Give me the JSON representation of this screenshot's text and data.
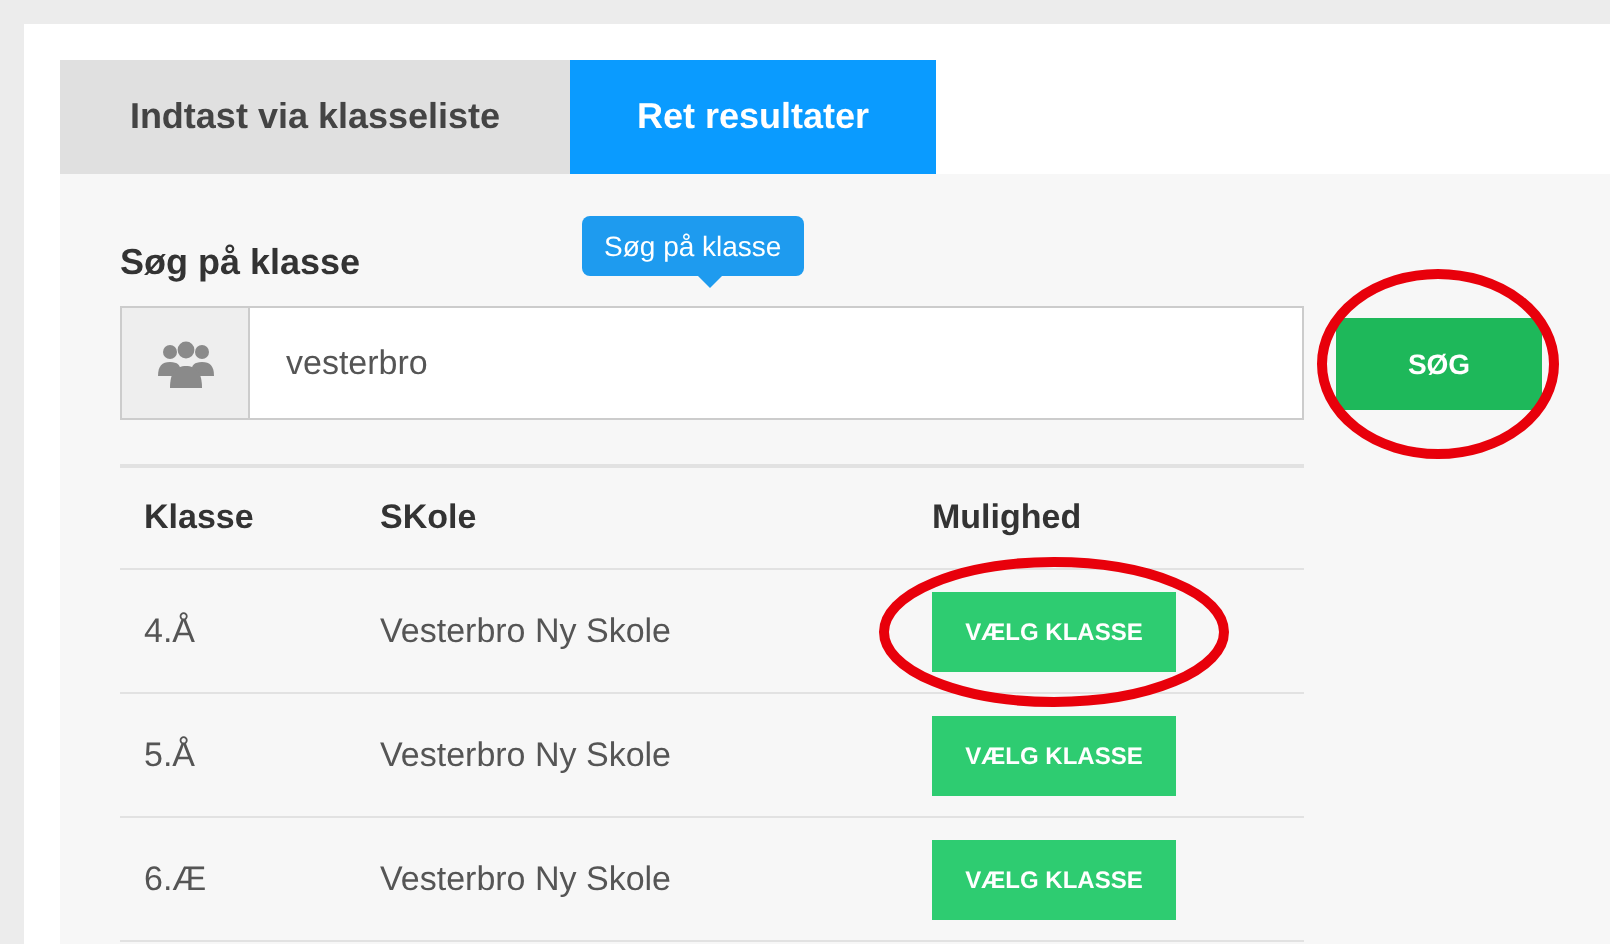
{
  "tabs": [
    {
      "label": "Indtast via klasseliste",
      "selected": false
    },
    {
      "label": "Ret resultater",
      "selected": true
    }
  ],
  "search": {
    "label": "Søg på klasse",
    "tooltip": "Søg på klasse",
    "value": "vesterbro",
    "button": "SØG",
    "circled": true
  },
  "table": {
    "columns": [
      "Klasse",
      "SKole",
      "Mulighed"
    ],
    "rows": [
      {
        "klasse": "4.Å",
        "skole": "Vesterbro Ny Skole",
        "action": "VÆLG KLASSE",
        "circled": true
      },
      {
        "klasse": "5.Å",
        "skole": "Vesterbro Ny Skole",
        "action": "VÆLG KLASSE",
        "circled": false
      },
      {
        "klasse": "6.Æ",
        "skole": "Vesterbro Ny Skole",
        "action": "VÆLG KLASSE",
        "circled": false
      }
    ]
  }
}
